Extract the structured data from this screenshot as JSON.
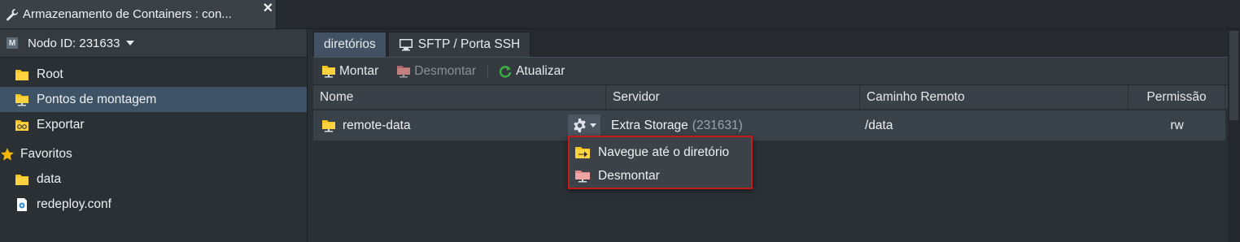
{
  "window": {
    "tab_title": "Armazenamento de Containers : con...",
    "close_glyph": "✕"
  },
  "sidebar": {
    "node_title": "Nodo ID: 231633",
    "node_badge": "M",
    "items": [
      {
        "label": "Root",
        "icon": "folder-icon"
      },
      {
        "label": "Pontos de montagem",
        "icon": "mount-folder-icon",
        "selected": true
      },
      {
        "label": "Exportar",
        "icon": "export-icon"
      }
    ],
    "favorites_label": "Favoritos",
    "favorites": [
      {
        "label": "data",
        "icon": "folder-icon"
      },
      {
        "label": "redeploy.conf",
        "icon": "config-file-icon"
      }
    ]
  },
  "tabs": [
    {
      "label": "diretórios",
      "active": true
    },
    {
      "label": "SFTP / Porta SSH",
      "active": false
    }
  ],
  "toolbar": {
    "mount_label": "Montar",
    "unmount_label": "Desmontar",
    "refresh_label": "Atualizar"
  },
  "table": {
    "columns": [
      "Nome",
      "Servidor",
      "Caminho Remoto",
      "Permissão"
    ],
    "rows": [
      {
        "name": "remote-data",
        "server": "Extra Storage",
        "server_id": "(231631)",
        "path": "/data",
        "permission": "rw"
      }
    ]
  },
  "context_menu": {
    "items": [
      {
        "label": "Navegue até o diretório",
        "icon": "navigate-folder-icon"
      },
      {
        "label": "Desmontar",
        "icon": "unmount-icon"
      }
    ]
  },
  "colors": {
    "accent_selected": "#3f5366",
    "folder_yellow": "#f5c518",
    "menu_outline": "#c41c1c",
    "refresh_green": "#3cb043"
  }
}
